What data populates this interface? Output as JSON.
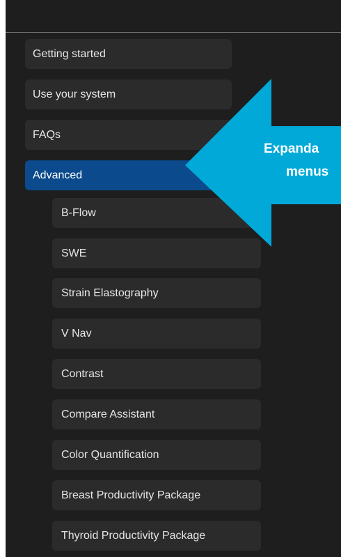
{
  "menu": {
    "items": [
      {
        "label": "Getting started"
      },
      {
        "label": "Use your system"
      },
      {
        "label": "FAQs"
      },
      {
        "label": "Advanced",
        "active": true
      }
    ],
    "subitems": [
      {
        "label": "B-Flow"
      },
      {
        "label": "SWE"
      },
      {
        "label": "Strain Elastography"
      },
      {
        "label": "V Nav"
      },
      {
        "label": "Contrast"
      },
      {
        "label": "Compare Assistant"
      },
      {
        "label": "Color Quantification"
      },
      {
        "label": "Breast Productivity Package"
      },
      {
        "label": "Thyroid Productivity Package"
      }
    ]
  },
  "callout": {
    "line1": "Expanda",
    "line2": "menus",
    "color": "#00a9d8"
  },
  "colors": {
    "background": "#1e1e1e",
    "item_background": "#2b2b2b",
    "active_background": "#0b4a8c"
  }
}
